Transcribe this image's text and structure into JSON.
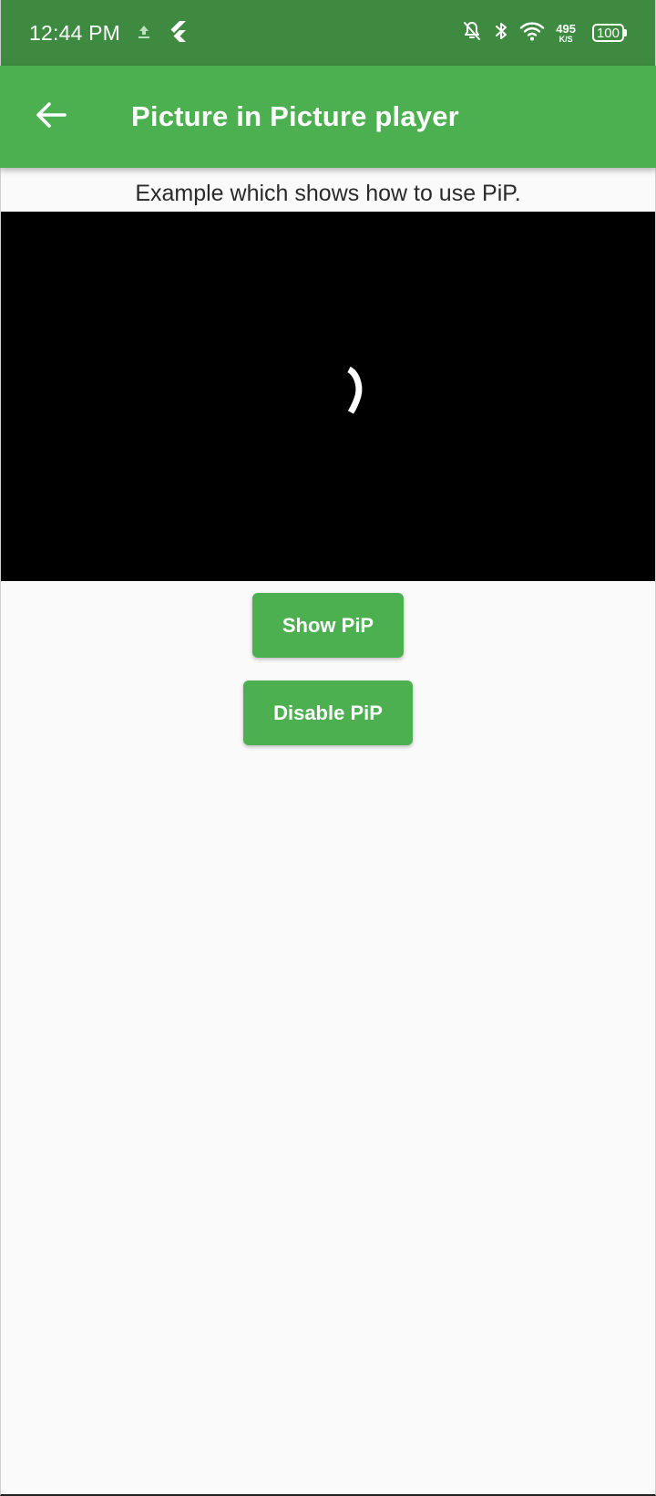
{
  "status_bar": {
    "time": "12:44 PM",
    "left_icons": [
      "upload-icon",
      "flutter-icon"
    ],
    "right_icons": [
      "notifications-off-icon",
      "bluetooth-icon",
      "wifi-icon"
    ],
    "net_speed_value": "495",
    "net_speed_unit": "K/S",
    "battery_level": "100"
  },
  "app_bar": {
    "back_icon": "arrow-back-icon",
    "title": "Picture in Picture player"
  },
  "content": {
    "subtitle": "Example which shows how to use PiP."
  },
  "player": {
    "state": "loading",
    "spinner_icon": "loading-spinner-icon"
  },
  "buttons": {
    "show_pip": "Show PiP",
    "disable_pip": "Disable PiP"
  },
  "colors": {
    "status_bar": "#3d8a40",
    "app_bar": "#4caf50",
    "button": "#4caf50",
    "background": "#fafafa",
    "player_background": "#000000"
  }
}
